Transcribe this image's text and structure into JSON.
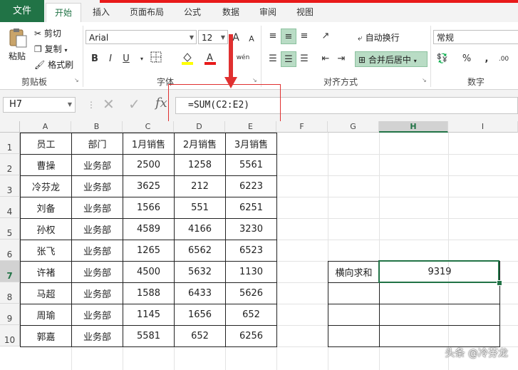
{
  "tabs": {
    "file": "文件",
    "home": "开始",
    "insert": "插入",
    "layout": "页面布局",
    "formulas": "公式",
    "data": "数据",
    "review": "审阅",
    "view": "视图"
  },
  "clipboard": {
    "paste": "粘贴",
    "cut": "剪切",
    "copy": "复制",
    "painter": "格式刷",
    "label": "剪贴板"
  },
  "font": {
    "name": "Arial",
    "size": "12",
    "label": "字体",
    "bold": "B",
    "italic": "I",
    "underline": "U",
    "grow": "A",
    "shrink": "A",
    "phonetic": "wén"
  },
  "alignment": {
    "wrap": "自动换行",
    "merge": "合并后居中",
    "label": "对齐方式"
  },
  "number": {
    "format": "常规",
    "label": "数字",
    "percent": "%",
    "comma": ","
  },
  "formula_bar": {
    "cell_ref": "H7",
    "fx": "fx",
    "formula": "=SUM(C2:E2)"
  },
  "columns": [
    "A",
    "B",
    "C",
    "D",
    "E",
    "F",
    "G",
    "H",
    "I"
  ],
  "rows": [
    "1",
    "2",
    "3",
    "4",
    "5",
    "6",
    "7",
    "8",
    "9",
    "10"
  ],
  "table": {
    "headers": [
      "员工",
      "部门",
      "1月销售",
      "2月销售",
      "3月销售"
    ],
    "rows": [
      [
        "曹操",
        "业务部",
        "2500",
        "1258",
        "5561"
      ],
      [
        "冷芬龙",
        "业务部",
        "3625",
        "212",
        "6223"
      ],
      [
        "刘备",
        "业务部",
        "1566",
        "551",
        "6251"
      ],
      [
        "孙权",
        "业务部",
        "4589",
        "4166",
        "3230"
      ],
      [
        "张飞",
        "业务部",
        "1265",
        "6562",
        "6523"
      ],
      [
        "许褚",
        "业务部",
        "4500",
        "5632",
        "1130"
      ],
      [
        "马超",
        "业务部",
        "1588",
        "6433",
        "5626"
      ],
      [
        "周瑜",
        "业务部",
        "1145",
        "1656",
        "652"
      ],
      [
        "郭嘉",
        "业务部",
        "5581",
        "652",
        "6256"
      ]
    ]
  },
  "result": {
    "label": "横向求和",
    "value": "9319"
  },
  "watermark": "头条 @冷芬龙",
  "colors": {
    "accent": "#217346",
    "highlight": "#e03030"
  }
}
